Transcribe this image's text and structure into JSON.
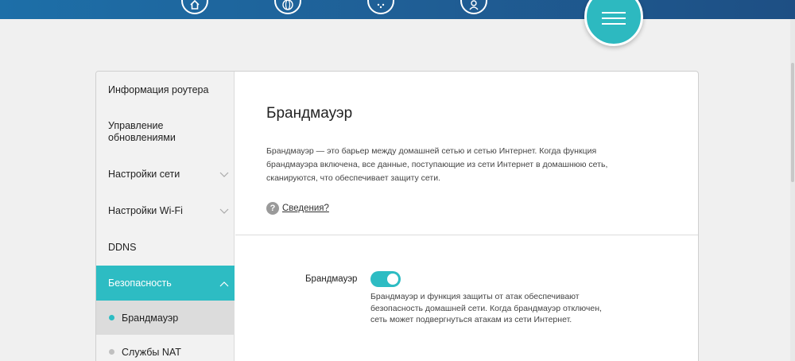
{
  "topnav": {
    "icons": [
      "home-icon",
      "globe-icon",
      "devices-icon",
      "user-icon"
    ],
    "menu_icon": "menu-icon",
    "accent_color": "#2dbcc3"
  },
  "sidebar": {
    "items": [
      {
        "label": "Информация роутера"
      },
      {
        "label": "Управление обновлениями"
      },
      {
        "label": "Настройки сети"
      },
      {
        "label": "Настройки Wi-Fi"
      },
      {
        "label": "DDNS"
      },
      {
        "label": "Безопасность"
      }
    ],
    "subitems": [
      {
        "label": "Брандмауэр"
      },
      {
        "label": "Службы NAT"
      }
    ]
  },
  "main": {
    "title": "Брандмауэр",
    "description": "Брандмауэр — это барьер между домашней сетью и сетью Интернет. Когда функция брандмауэра включена, все данные, поступающие из сети Интернет в домашнюю сеть, сканируются, что обеспечивает защиту сети.",
    "info_icon": "?",
    "info_link": "Сведения?",
    "setting": {
      "label": "Брандмауэр",
      "enabled": true,
      "help": "Брандмауэр и функция защиты от атак обеспечивают безопасность домашней сети. Когда брандмауэр отключен, сеть может подвергнуться атакам из сети Интернет."
    }
  }
}
